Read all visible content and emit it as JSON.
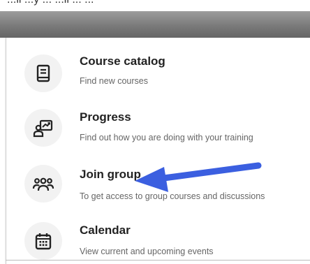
{
  "top_text": "...ll ...y ... ...ll ... ...",
  "menu": {
    "items": [
      {
        "title": "Course catalog",
        "description": "Find new courses",
        "icon": "book-icon"
      },
      {
        "title": "Progress",
        "description": "Find out how you are doing with your training",
        "icon": "progress-icon"
      },
      {
        "title": "Join group",
        "description": "To get access to group courses and discussions",
        "icon": "group-icon"
      },
      {
        "title": "Calendar",
        "description": "View current and upcoming events",
        "icon": "calendar-icon"
      }
    ]
  },
  "colors": {
    "arrow": "#3b5fe0",
    "header_bar": "#7a7a7a",
    "icon_bg": "#f2f2f2",
    "icon_stroke": "#222222"
  }
}
